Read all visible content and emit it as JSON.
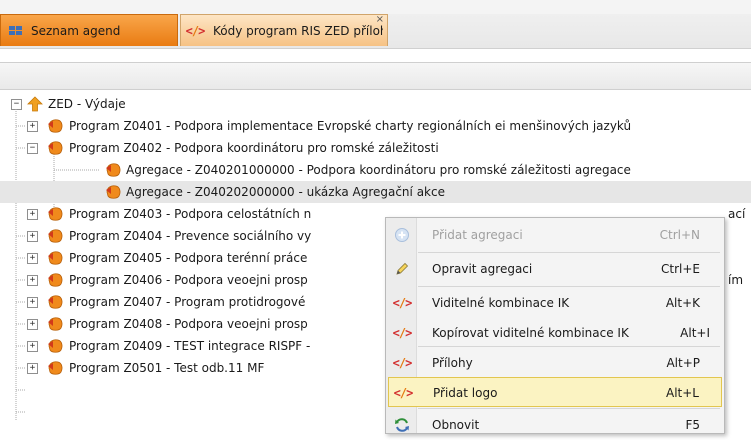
{
  "tabs": [
    {
      "label": "Seznam agend",
      "icon": "grid-icon",
      "active": true
    },
    {
      "label": "Kódy program RIS ZED příloha",
      "icon": "code-icon",
      "close": "×"
    }
  ],
  "tree": {
    "root": {
      "label": "ZED - Výdaje",
      "icon": "arrow-up-icon"
    },
    "rows": [
      {
        "label": "Program Z0401 - Podpora implementace Evropské charty regionálních ei menšinových jazyků",
        "expander": "+"
      },
      {
        "label": "Program Z0402 - Podpora koordinátoru pro romské záležitosti",
        "expander": "−"
      },
      {
        "label": "Agregace - Z040201000000 - Podpora koordinátoru pro romské záležitosti agregace"
      },
      {
        "label": "Agregace - Z040202000000 - ukázka Agregační akce",
        "selected": true
      },
      {
        "label": "Program Z0403 - Podpora celostátních n",
        "tail": "ací",
        "expander": "+"
      },
      {
        "label": "Program Z0404 - Prevence sociálního vy",
        "expander": "+"
      },
      {
        "label": "Program Z0405 - Podpora terénní práce",
        "expander": "+"
      },
      {
        "label": "Program Z0406 - Podpora veoejni prosp",
        "tail": "ím",
        "expander": "+"
      },
      {
        "label": "Program Z0407 - Program protidrogové",
        "expander": "+"
      },
      {
        "label": "Program Z0408 - Podpora veoejni prosp",
        "expander": "+"
      },
      {
        "label": "Program Z0409 - TEST integrace RISPF -",
        "expander": "+"
      },
      {
        "label": "Program Z0501 - Test odb.11 MF",
        "expander": "+"
      }
    ]
  },
  "context_menu": {
    "items": [
      {
        "label": "Přidat agregaci",
        "shortcut": "Ctrl+N",
        "icon": "add-circle-icon",
        "disabled": true
      },
      {
        "label": "Opravit agregaci",
        "shortcut": "Ctrl+E",
        "icon": "pencil-icon"
      },
      {
        "label": "Viditelné kombinace IK",
        "shortcut": "Alt+K",
        "icon": "code-icon"
      },
      {
        "label": "Kopírovat viditelné kombinace IK",
        "shortcut": "Alt+I",
        "icon": "code-icon"
      },
      {
        "label": "Přílohy",
        "shortcut": "Alt+P",
        "icon": "code-icon"
      },
      {
        "label": "Přidat logo",
        "shortcut": "Alt+L",
        "icon": "code-icon",
        "hover": true
      },
      {
        "label": "Obnovit",
        "shortcut": "F5",
        "icon": "refresh-icon"
      }
    ]
  },
  "colors": {
    "tab_active": "#e97b12",
    "tab_inactive": "#f6c285",
    "menu_hover": "#fbf3c2",
    "program_icon": "#f08a1c"
  }
}
